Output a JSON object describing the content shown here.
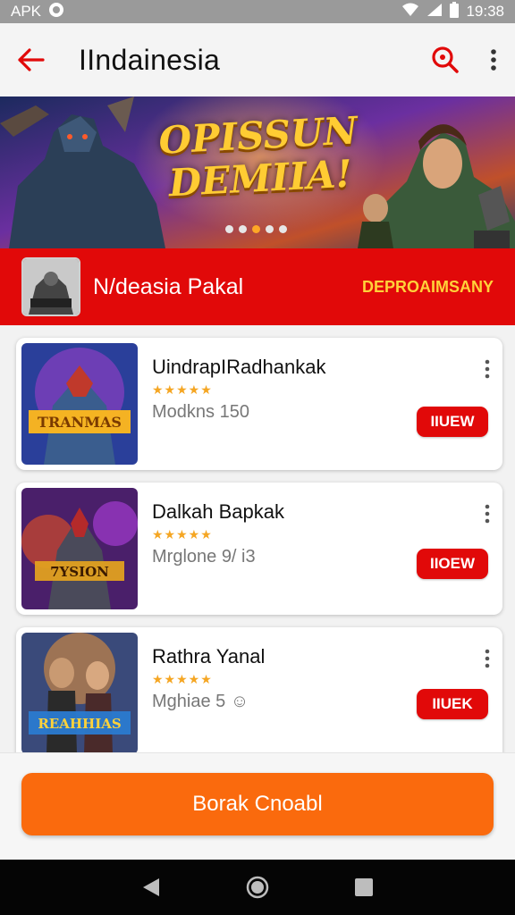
{
  "status_bar": {
    "carrier": "APK",
    "time": "19:38"
  },
  "app_bar": {
    "title": "IIndainesia"
  },
  "banner": {
    "title": "OPISSUN DEMIIA!"
  },
  "featured": {
    "name": "N/deasia Pakal",
    "tag": "DEPROAIMSANY"
  },
  "apps": [
    {
      "name": "UindrapIRadhankak",
      "stars": "★★★★★",
      "meta": "Modkns 150",
      "button": "IIUEW",
      "art_text": "TRANMAS"
    },
    {
      "name": "Dalkah Bapkak",
      "stars": "★★★★★",
      "meta": "Mrglone 9/ i3",
      "button": "IIOEW",
      "art_text": "7YSION"
    },
    {
      "name": "Rathra Yanal",
      "stars": "★★★★★",
      "meta": "Mghiae 5 ☺",
      "button": "IIUEK",
      "art_text": "REAHHIAS"
    }
  ],
  "cta": {
    "label": "Borak Cnoabl"
  },
  "colors": {
    "accent": "#e10909",
    "cta": "#fa6a0d",
    "star": "#f5a623"
  }
}
